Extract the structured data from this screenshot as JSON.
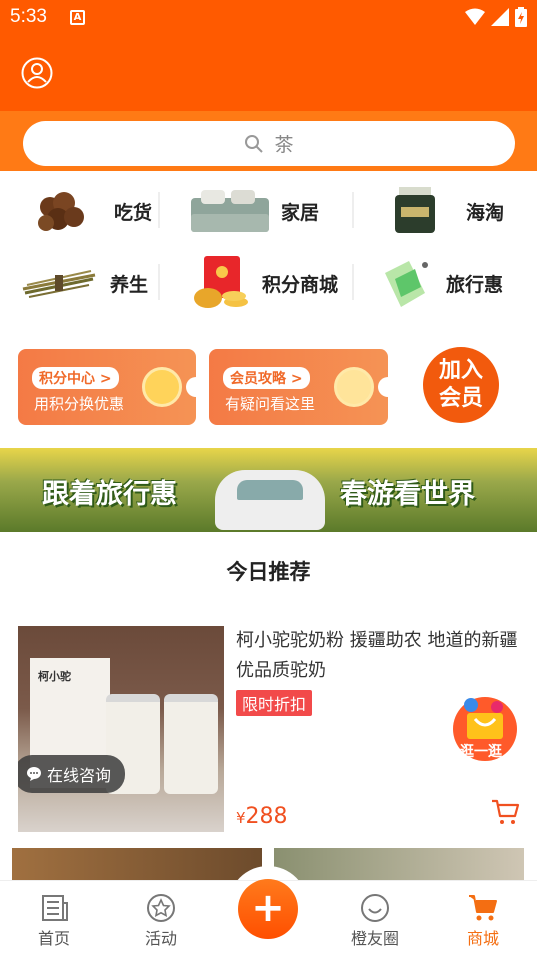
{
  "status_bar": {
    "time": "5:33",
    "app_icon_letter": "A"
  },
  "header": {
    "avatar_icon": "user-circle-icon"
  },
  "search": {
    "placeholder": "茶"
  },
  "categories": [
    {
      "label": "吃货",
      "icon": "snack-icon"
    },
    {
      "label": "家居",
      "icon": "bedding-icon"
    },
    {
      "label": "海淘",
      "icon": "cosmetics-jar-icon"
    },
    {
      "label": "养生",
      "icon": "herb-icon"
    },
    {
      "label": "积分商城",
      "icon": "red-envelope-coins-icon"
    },
    {
      "label": "旅行惠",
      "icon": "travel-icon"
    }
  ],
  "promo_cards": [
    {
      "tag": "积分中心 >",
      "sub": "用积分换优惠"
    },
    {
      "tag": "会员攻略 >",
      "sub": "有疑问看这里"
    }
  ],
  "join": {
    "line1": "加入",
    "line2": "会员"
  },
  "banner": {
    "left_text": "跟着旅行惠",
    "right_text": "春游看世界"
  },
  "section_title": "今日推荐",
  "product": {
    "title": "柯小驼驼奶粉 援疆助农 地道的新疆优品质驼奶",
    "badge": "限时折扣",
    "currency": "¥",
    "price": "288",
    "consult": "在线咨询",
    "box_brand": "柯小驼"
  },
  "float_button": {
    "label": "逛一逛"
  },
  "tabs": [
    {
      "label": "首页",
      "icon": "newspaper-icon",
      "active": false
    },
    {
      "label": "活动",
      "icon": "star-circle-icon",
      "active": false
    },
    {
      "label": "橙友圈",
      "icon": "smile-circle-icon",
      "active": false
    },
    {
      "label": "商城",
      "icon": "cart-icon",
      "active": true
    }
  ],
  "fab": {
    "symbol": "+"
  },
  "colors": {
    "brand": "#ff5a00",
    "accent": "#f46e12",
    "badge": "#f24a4a",
    "price": "#f05020"
  }
}
